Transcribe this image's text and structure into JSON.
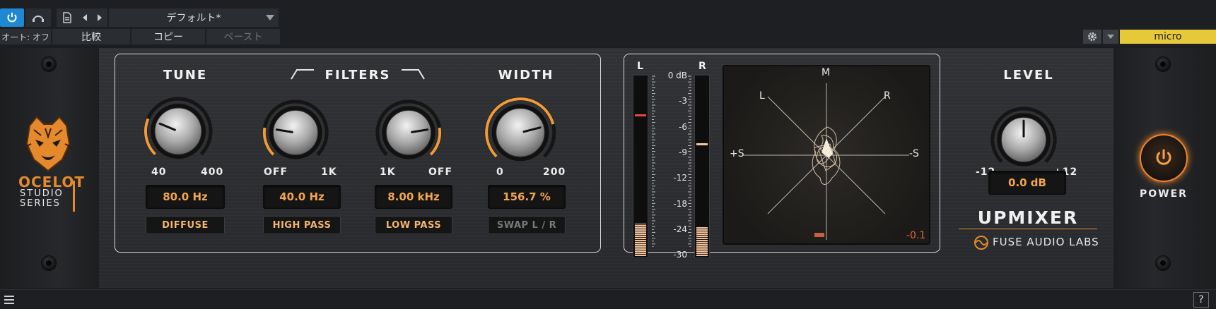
{
  "host": {
    "preset_name": "デフォルト*",
    "auto_label": "オート: オフ",
    "compare_label": "比較",
    "copy_label": "コピー",
    "paste_label": "ペースト",
    "device_label": "micro"
  },
  "plugin": {
    "brand_line1": "OCELOT",
    "brand_line2": "STUDIO",
    "brand_line3": "SERIES",
    "tune": {
      "title": "TUNE",
      "min_label": "40",
      "max_label": "400",
      "value": "80.0 Hz",
      "button": "DIFFUSE",
      "level": 0.25
    },
    "filters": {
      "title": "FILTERS",
      "highpass": {
        "min_label": "OFF",
        "max_label": "1K",
        "value": "40.0 Hz",
        "button": "HIGH PASS",
        "level": 0.2
      },
      "lowpass": {
        "min_label": "1K",
        "max_label": "OFF",
        "value": "8.00 kHz",
        "button": "LOW PASS",
        "level": 0.8
      }
    },
    "width": {
      "title": "WIDTH",
      "min_label": "0",
      "max_label": "200",
      "value": "156.7 %",
      "button": "SWAP L / R",
      "level": 0.78
    },
    "meters": {
      "left_label": "L",
      "right_label": "R",
      "scale": [
        "0 dB",
        "-3",
        "-6",
        "-9",
        "-12",
        "-18",
        "-24",
        "-30"
      ],
      "left_fill": 0.18,
      "right_fill": 0.16,
      "left_peak": 0.78,
      "right_peak": 0.62
    },
    "vectorscope": {
      "label_m": "M",
      "label_l": "L",
      "label_r": "R",
      "label_plus_s": "+S",
      "label_minus_s": "-S",
      "readout": "-0.1"
    },
    "level": {
      "title": "LEVEL",
      "min_label": "-12",
      "max_label": "+12",
      "value": "0.0 dB",
      "level": 0.5
    },
    "product_name": "UPMIXER",
    "maker": "FUSE AUDIO LABS",
    "power_label": "POWER",
    "colors": {
      "accent": "#f29a3a",
      "value_text": "#f4a64e",
      "peak_left": "#e24a3c",
      "peak_right": "#f2c9a0"
    }
  }
}
